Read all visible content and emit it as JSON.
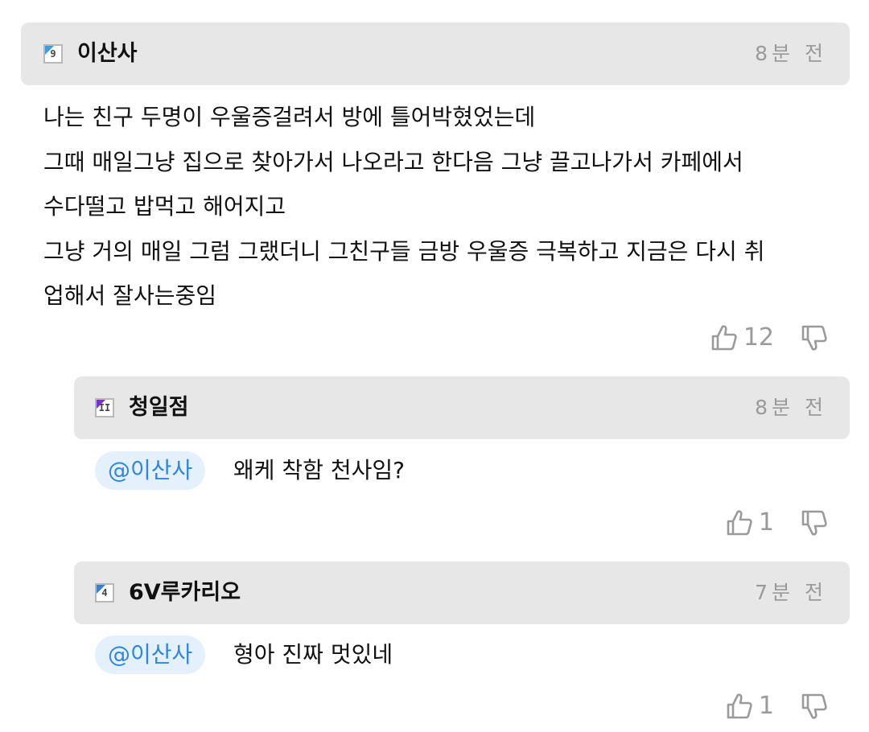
{
  "comments": [
    {
      "user": "이산사",
      "level": "9",
      "badge_color": "#3a9be6",
      "time": "8분 전",
      "body_lines": [
        "나는 친구 두명이 우울증걸려서 방에 틀어박혔었는데",
        "그때 매일그냥 집으로 찾아가서 나오라고 한다음 그냥 끌고나가서 카페에서",
        "수다떨고 밥먹고 해어지고",
        "그냥 거의 매일 그럼 그랬더니 그친구들 금방 우울증 극복하고 지금은 다시 취",
        "업해서 잘사는중임"
      ],
      "likes": "12",
      "like_icon": "thumbs-up-icon",
      "dislike_icon": "thumbs-down-icon"
    }
  ],
  "replies": [
    {
      "user": "청일점",
      "level": "II",
      "badge_color": "#7a2fd8",
      "time": "8분 전",
      "mention": "@이산사",
      "text": "왜케 착함 천사임?",
      "likes": "1"
    },
    {
      "user": "6V루카리오",
      "level": "4",
      "badge_color": "#3a7fd6",
      "time": "7분 전",
      "mention": "@이산사",
      "text": "형아 진짜 멋있네",
      "likes": "1"
    }
  ]
}
